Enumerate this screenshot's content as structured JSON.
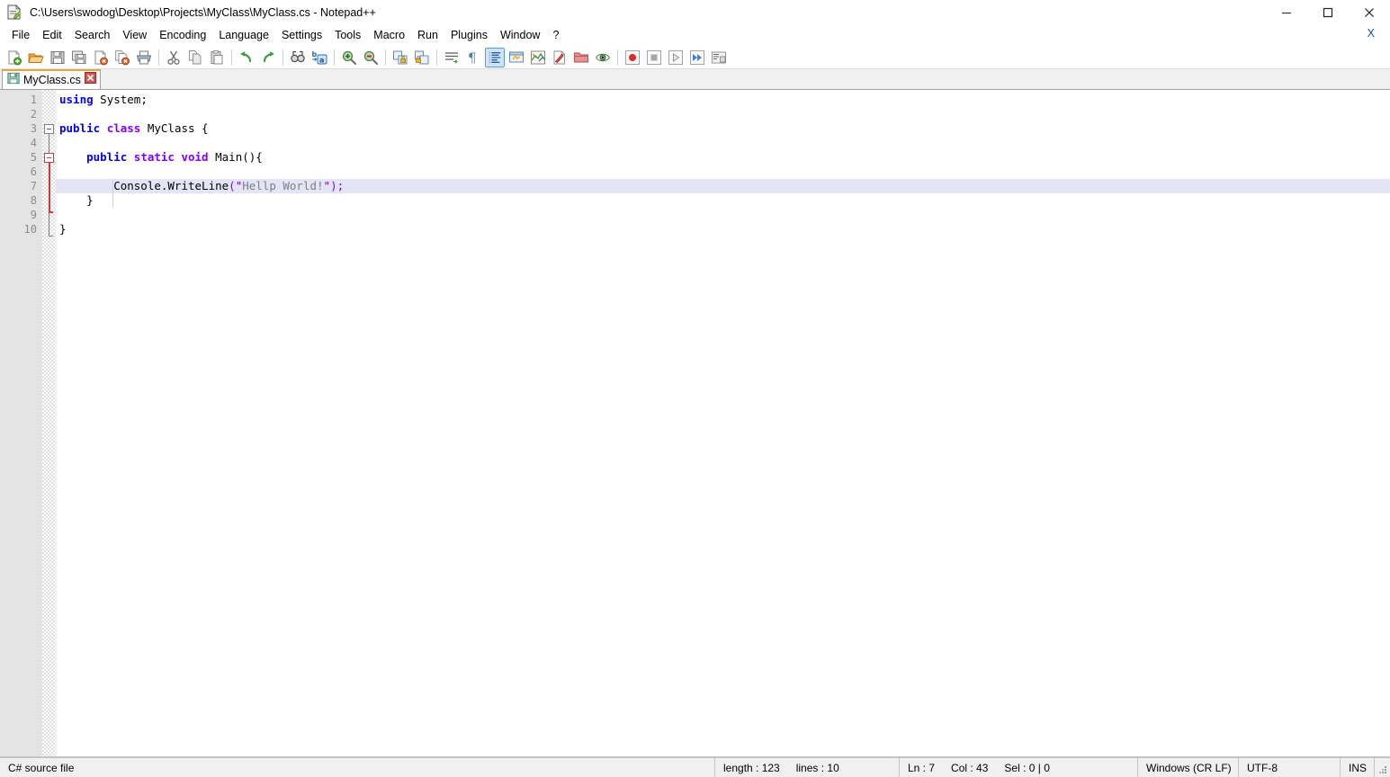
{
  "window": {
    "title": "C:\\Users\\swodog\\Desktop\\Projects\\MyClass\\MyClass.cs - Notepad++",
    "app_icon": "notepad-plus-plus-icon",
    "controls": {
      "minimize": "minimize-icon",
      "maximize": "maximize-icon",
      "close": "close-icon"
    }
  },
  "menubar": {
    "items": [
      {
        "label": "File",
        "name": "menu-file"
      },
      {
        "label": "Edit",
        "name": "menu-edit"
      },
      {
        "label": "Search",
        "name": "menu-search"
      },
      {
        "label": "View",
        "name": "menu-view"
      },
      {
        "label": "Encoding",
        "name": "menu-encoding"
      },
      {
        "label": "Language",
        "name": "menu-language"
      },
      {
        "label": "Settings",
        "name": "menu-settings"
      },
      {
        "label": "Tools",
        "name": "menu-tools"
      },
      {
        "label": "Macro",
        "name": "menu-macro"
      },
      {
        "label": "Run",
        "name": "menu-run"
      },
      {
        "label": "Plugins",
        "name": "menu-plugins"
      },
      {
        "label": "Window",
        "name": "menu-window"
      },
      {
        "label": "?",
        "name": "menu-help"
      }
    ],
    "close_document": "X"
  },
  "toolbar": {
    "buttons": [
      {
        "name": "new-file-icon",
        "tip": "New"
      },
      {
        "name": "open-file-icon",
        "tip": "Open"
      },
      {
        "name": "save-icon",
        "tip": "Save"
      },
      {
        "name": "save-all-icon",
        "tip": "Save All"
      },
      {
        "name": "close-file-icon",
        "tip": "Close"
      },
      {
        "name": "close-all-files-icon",
        "tip": "Close All"
      },
      {
        "name": "print-icon",
        "tip": "Print"
      },
      {
        "name": "separator-1",
        "tip": ""
      },
      {
        "name": "cut-icon",
        "tip": "Cut"
      },
      {
        "name": "copy-icon",
        "tip": "Copy"
      },
      {
        "name": "paste-icon",
        "tip": "Paste"
      },
      {
        "name": "separator-2",
        "tip": ""
      },
      {
        "name": "undo-icon",
        "tip": "Undo"
      },
      {
        "name": "redo-icon",
        "tip": "Redo"
      },
      {
        "name": "separator-3",
        "tip": ""
      },
      {
        "name": "find-icon",
        "tip": "Find"
      },
      {
        "name": "replace-icon",
        "tip": "Replace"
      },
      {
        "name": "separator-4",
        "tip": ""
      },
      {
        "name": "zoom-in-icon",
        "tip": "Zoom In"
      },
      {
        "name": "zoom-out-icon",
        "tip": "Zoom Out"
      },
      {
        "name": "separator-5",
        "tip": ""
      },
      {
        "name": "sync-vertical-scroll-icon",
        "tip": "Synchronize Vertical Scrolling"
      },
      {
        "name": "sync-horizontal-scroll-icon",
        "tip": "Synchronize Horizontal Scrolling"
      },
      {
        "name": "separator-6",
        "tip": ""
      },
      {
        "name": "word-wrap-icon",
        "tip": "Word Wrap"
      },
      {
        "name": "show-all-characters-icon",
        "tip": "Show All Characters"
      },
      {
        "name": "show-indent-guide-icon",
        "tip": "Show Indent Guide",
        "pressed": true
      },
      {
        "name": "user-defined-dialog-icon",
        "tip": "User Defined Dialogue"
      },
      {
        "name": "document-map-icon",
        "tip": "Document Map"
      },
      {
        "name": "function-list-icon",
        "tip": "Function List"
      },
      {
        "name": "folder-as-workspace-icon",
        "tip": "Folder as Workspace"
      },
      {
        "name": "monitoring-icon",
        "tip": "Monitoring"
      },
      {
        "name": "separator-7",
        "tip": ""
      },
      {
        "name": "macro-record-icon",
        "tip": "Start Recording"
      },
      {
        "name": "macro-stop-icon",
        "tip": "Stop Recording"
      },
      {
        "name": "macro-play-icon",
        "tip": "Playback"
      },
      {
        "name": "macro-run-multiple-icon",
        "tip": "Run a Macro Multiple Times"
      },
      {
        "name": "macro-save-icon",
        "tip": "Save Current Recorded Macro"
      }
    ]
  },
  "tabs": [
    {
      "label": "MyClass.cs",
      "icon": "saved-file-icon",
      "close": "close-tab-icon",
      "active": true
    }
  ],
  "editor": {
    "line_numbers": [
      "1",
      "2",
      "3",
      "4",
      "5",
      "6",
      "7",
      "8",
      "9",
      "10"
    ],
    "current_line": 7,
    "lines": [
      {
        "n": 1,
        "tokens": [
          {
            "t": "using",
            "c": "k-blue"
          },
          {
            "t": " System;",
            "c": "k-plain"
          }
        ]
      },
      {
        "n": 2,
        "tokens": []
      },
      {
        "n": 3,
        "tokens": [
          {
            "t": "public",
            "c": "k-blue"
          },
          {
            "t": " ",
            "c": "k-plain"
          },
          {
            "t": "class",
            "c": "k-purple"
          },
          {
            "t": " MyClass {",
            "c": "k-plain"
          }
        ]
      },
      {
        "n": 4,
        "tokens": []
      },
      {
        "n": 5,
        "tokens": [
          {
            "t": "    ",
            "c": "k-plain"
          },
          {
            "t": "public",
            "c": "k-blue"
          },
          {
            "t": " ",
            "c": "k-plain"
          },
          {
            "t": "static",
            "c": "k-purple"
          },
          {
            "t": " ",
            "c": "k-plain"
          },
          {
            "t": "void",
            "c": "k-purple"
          },
          {
            "t": " Main(){",
            "c": "k-plain"
          }
        ]
      },
      {
        "n": 6,
        "tokens": []
      },
      {
        "n": 7,
        "tokens": [
          {
            "t": "        Console.WriteLine",
            "c": "k-plain"
          },
          {
            "t": "(",
            "c": "k-op"
          },
          {
            "t": "\"",
            "c": "k-op"
          },
          {
            "t": "Hellp World!",
            "c": "k-str"
          },
          {
            "t": "\"",
            "c": "k-op"
          },
          {
            "t": ")",
            "c": "k-op"
          },
          {
            "t": ";",
            "c": "k-op"
          }
        ]
      },
      {
        "n": 8,
        "tokens": [
          {
            "t": "    }",
            "c": "k-plain"
          }
        ]
      },
      {
        "n": 9,
        "tokens": []
      },
      {
        "n": 10,
        "tokens": [
          {
            "t": "}",
            "c": "k-plain"
          }
        ]
      }
    ],
    "folds": [
      {
        "line": 3,
        "type": "box",
        "active": false
      },
      {
        "line": 5,
        "type": "box",
        "active": true
      }
    ]
  },
  "statusbar": {
    "file_type": "C# source file",
    "length_label": "length : 123",
    "lines_label": "lines : 10",
    "ln": "Ln : 7",
    "col": "Col : 43",
    "sel": "Sel : 0 | 0",
    "eol": "Windows (CR LF)",
    "encoding": "UTF-8",
    "insert_mode": "INS"
  },
  "colors": {
    "keyword_blue": "#0000ff",
    "keyword_purple": "#8000ff",
    "string_grey": "#808080",
    "current_line_highlight": "#e4e4f7",
    "gutter_bg": "#e4e4e4",
    "tab_accent": "#e8a33d",
    "fold_active": "#d13a3a"
  }
}
